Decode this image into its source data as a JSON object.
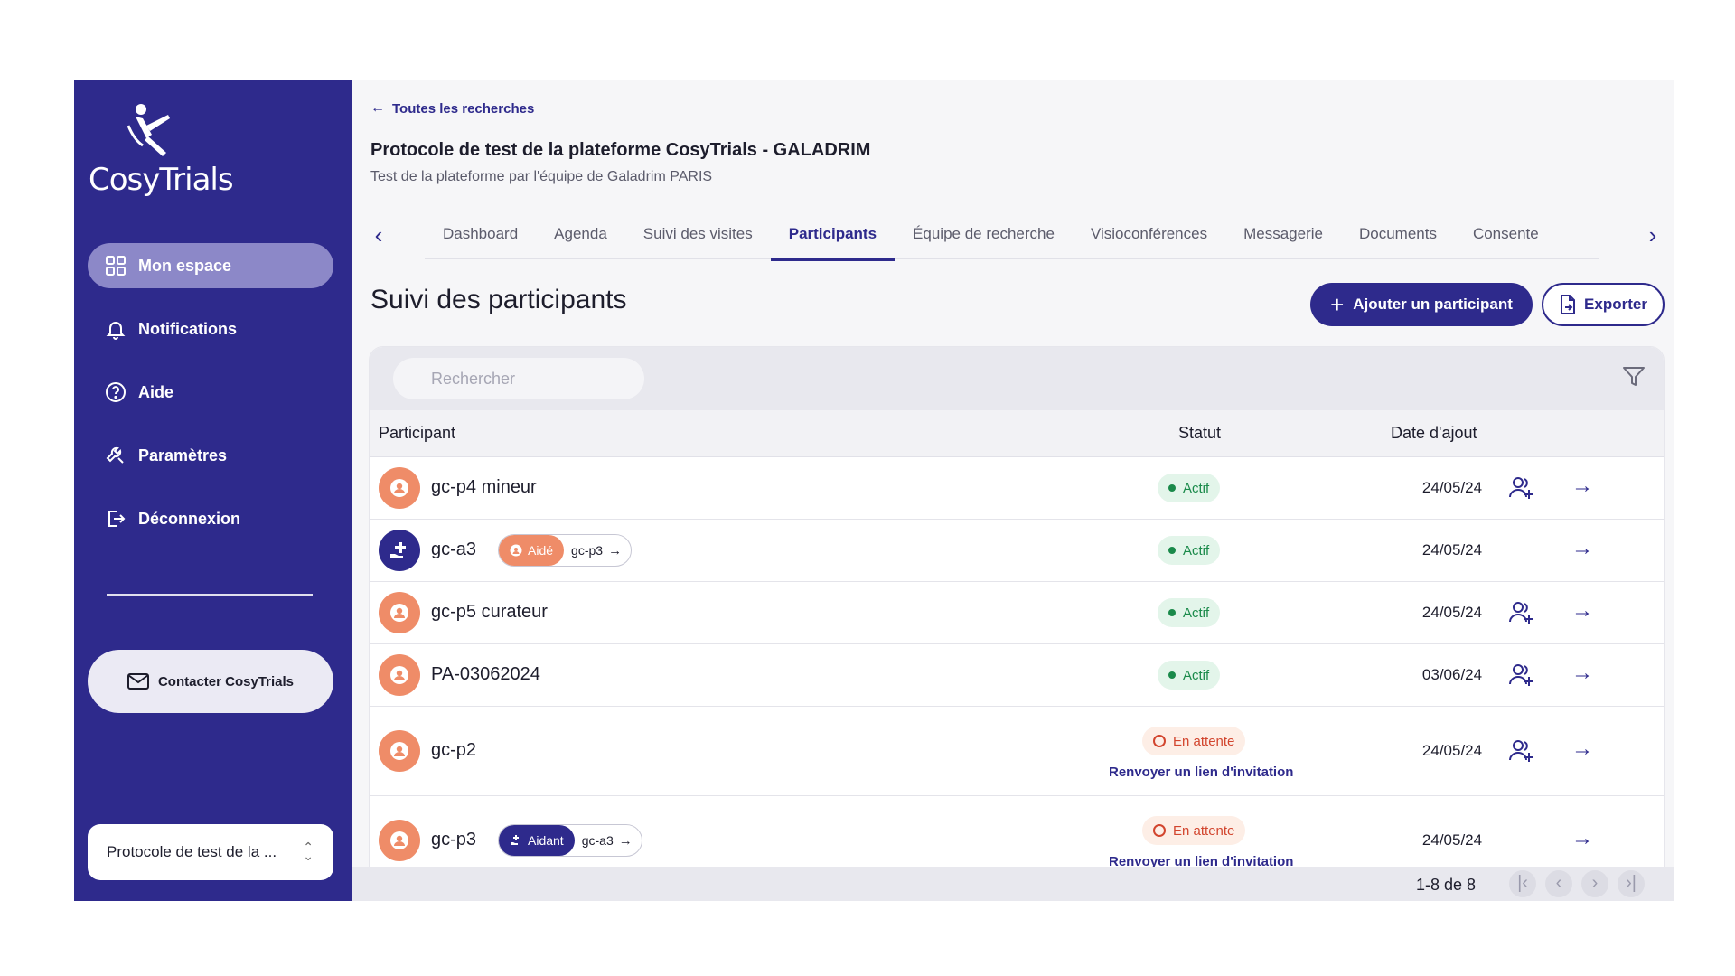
{
  "brand": {
    "logo_text": "CosyTrials"
  },
  "sidebar": {
    "items": [
      {
        "label": "Mon espace",
        "icon": "grid-icon"
      },
      {
        "label": "Notifications",
        "icon": "bell-icon"
      },
      {
        "label": "Aide",
        "icon": "help-circle-icon"
      },
      {
        "label": "Paramètres",
        "icon": "wrench-icon"
      },
      {
        "label": "Déconnexion",
        "icon": "logout-icon"
      }
    ],
    "contact_label": "Contacter CosyTrials",
    "protocol_select": "Protocole de test de la ..."
  },
  "header": {
    "back_label": "Toutes les recherches",
    "title": "Protocole de test de la plateforme CosyTrials - GALADRIM",
    "subtitle": "Test de la plateforme par l'équipe de Galadrim PARIS"
  },
  "tabs": [
    {
      "label": "Dashboard"
    },
    {
      "label": "Agenda"
    },
    {
      "label": "Suivi des visites"
    },
    {
      "label": "Participants",
      "active": true
    },
    {
      "label": "Équipe de recherche"
    },
    {
      "label": "Visioconférences"
    },
    {
      "label": "Messagerie"
    },
    {
      "label": "Documents"
    },
    {
      "label": "Consente"
    }
  ],
  "main": {
    "section_title": "Suivi des participants",
    "add_button": "Ajouter un participant",
    "export_button": "Exporter",
    "search_placeholder": "Rechercher",
    "columns": {
      "participant": "Participant",
      "status": "Statut",
      "date": "Date d'ajout"
    }
  },
  "rows": [
    {
      "name": "gc-p4 mineur",
      "status": "Actif",
      "date": "24/05/24"
    },
    {
      "name": "gc-a3",
      "rel_tag": "Aidé",
      "rel_code": "gc-p3",
      "status": "Actif",
      "date": "24/05/24"
    },
    {
      "name": "gc-p5 curateur",
      "status": "Actif",
      "date": "24/05/24"
    },
    {
      "name": "PA-03062024",
      "status": "Actif",
      "date": "03/06/24"
    },
    {
      "name": "gc-p2",
      "status": "En attente",
      "resend": "Renvoyer un lien d'invitation",
      "date": "24/05/24"
    },
    {
      "name": "gc-p3",
      "rel_tag": "Aidant",
      "rel_code": "gc-a3",
      "status": "En attente",
      "resend": "Renvoyer un lien d'invitation",
      "date": "24/05/24"
    }
  ],
  "pagination": {
    "label": "1-8 de 8"
  },
  "colors": {
    "primary": "#2e2a8c",
    "accent": "#ef8c68",
    "active_green": "#1a8a4a",
    "pending_red": "#d2452e"
  }
}
